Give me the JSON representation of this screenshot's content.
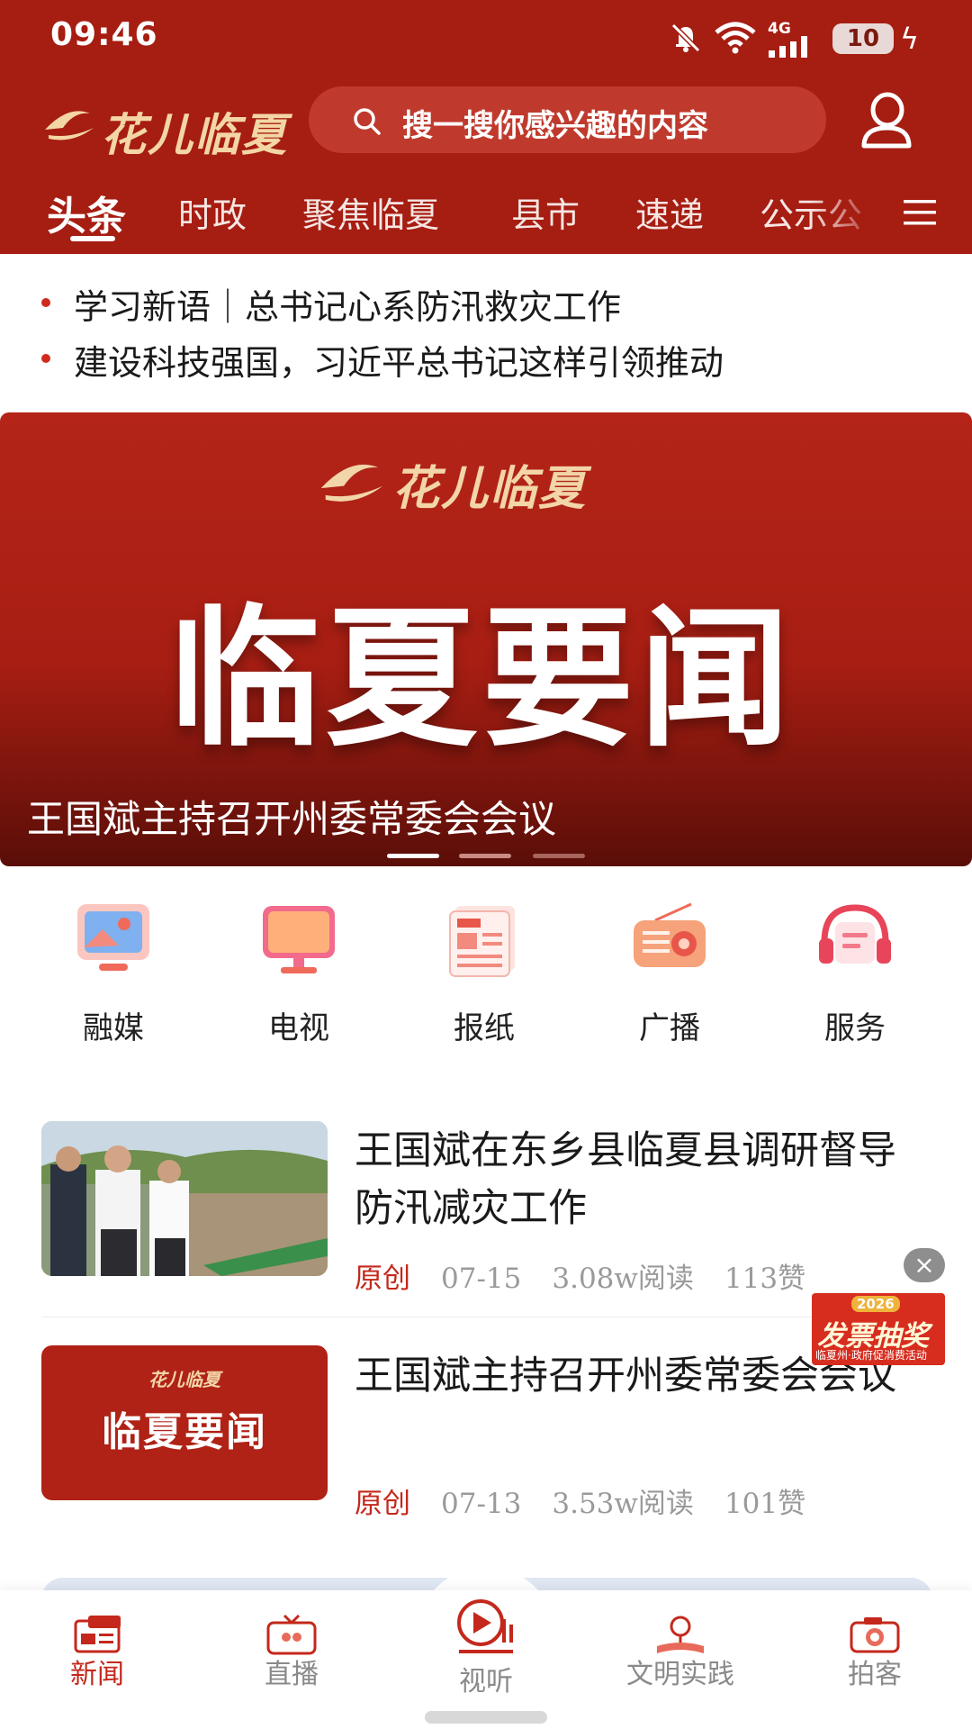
{
  "status_bar": {
    "time": "09:46",
    "network": "4G",
    "battery": "10"
  },
  "header": {
    "logo_text": "花儿临夏",
    "search_placeholder": "搜一搜你感兴趣的内容",
    "tabs": [
      "头条",
      "时政",
      "聚焦临夏",
      "县市",
      "速递",
      "公示公"
    ],
    "active_tab": 0
  },
  "headlines": [
    "学习新语｜总书记心系防汛救灾工作",
    "建设科技强国，习近平总书记这样引领推动"
  ],
  "banner": {
    "logo_text": "花儿临夏",
    "title": "临夏要闻",
    "caption": "王国斌主持召开州委常委会会议",
    "pages": 3,
    "active_page": 0
  },
  "services": [
    {
      "label": "融媒",
      "icon": "media-icon"
    },
    {
      "label": "电视",
      "icon": "tv-icon"
    },
    {
      "label": "报纸",
      "icon": "newspaper-icon"
    },
    {
      "label": "广播",
      "icon": "radio-icon"
    },
    {
      "label": "服务",
      "icon": "headset-icon"
    }
  ],
  "news": [
    {
      "title": "王国斌在东乡县临夏县调研督导防汛减灾工作",
      "tag": "原创",
      "date": "07-15",
      "reads": "3.08w阅读",
      "likes": "113赞"
    },
    {
      "title": "王国斌主持召开州委常委会会议",
      "tag": "原创",
      "date": "07-13",
      "reads": "3.53w阅读",
      "likes": "101赞",
      "thumb_logo": "花儿临夏",
      "thumb_title": "临夏要闻"
    }
  ],
  "floating_ad": {
    "year": "2026",
    "title": "发票抽奖",
    "subtitle": "临夏州·政府促消费活动",
    "close": "×"
  },
  "bottom_nav": [
    {
      "label": "新闻",
      "icon": "news-icon",
      "active": true
    },
    {
      "label": "直播",
      "icon": "live-tv-icon",
      "active": false
    },
    {
      "label": "视听",
      "icon": "play-icon",
      "active": false
    },
    {
      "label": "文明实践",
      "icon": "civilization-icon",
      "active": false
    },
    {
      "label": "拍客",
      "icon": "camera-icon",
      "active": false
    }
  ],
  "colors": {
    "brand_red": "#a61d12",
    "accent_red": "#c4281c",
    "meta_gray": "#9a9a9a"
  }
}
